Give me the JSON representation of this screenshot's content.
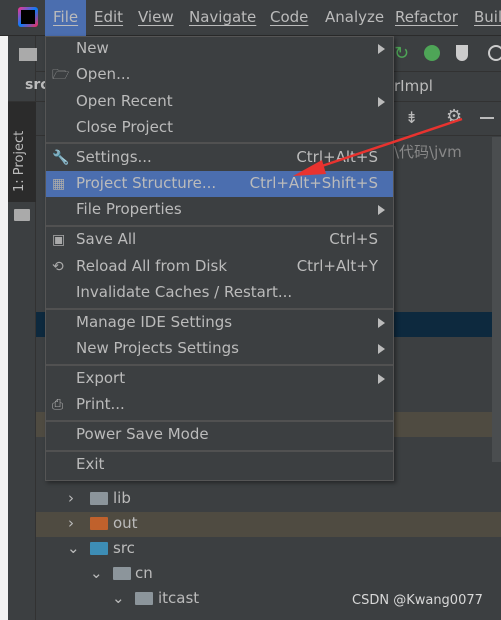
{
  "menubar": {
    "items": [
      "File",
      "Edit",
      "View",
      "Navigate",
      "Code",
      "Analyze",
      "Refactor",
      "Buil"
    ]
  },
  "sidebar": {
    "project_tab": "1: Project"
  },
  "tabs": {
    "left": "src",
    "right": "rImpl"
  },
  "path_text": "\\代码\\jvm",
  "tree": [
    {
      "label": "lib",
      "color": "#8c959b"
    },
    {
      "label": "out",
      "color": "#c0612c"
    },
    {
      "label": "src",
      "color": "#3d8db5"
    },
    {
      "label": "cn",
      "color": "#8c959b"
    },
    {
      "label": "itcast",
      "color": "#8c959b"
    }
  ],
  "file_menu": {
    "items": [
      {
        "label": "New",
        "submenu": true
      },
      {
        "label": "Open...",
        "icon": "folder-open-icon"
      },
      {
        "label": "Open Recent",
        "submenu": true
      },
      {
        "label": "Close Project"
      },
      {
        "label": "Settings...",
        "shortcut": "Ctrl+Alt+S",
        "icon": "wrench-icon"
      },
      {
        "label": "Project Structure...",
        "shortcut": "Ctrl+Alt+Shift+S",
        "icon": "project-structure-icon",
        "selected": true
      },
      {
        "label": "File Properties",
        "submenu": true
      },
      {
        "label": "Save All",
        "shortcut": "Ctrl+S",
        "icon": "save-icon"
      },
      {
        "label": "Reload All from Disk",
        "shortcut": "Ctrl+Alt+Y",
        "icon": "reload-icon"
      },
      {
        "label": "Invalidate Caches / Restart..."
      },
      {
        "label": "Manage IDE Settings",
        "submenu": true
      },
      {
        "label": "New Projects Settings",
        "submenu": true
      },
      {
        "label": "Export",
        "submenu": true
      },
      {
        "label": "Print...",
        "icon": "print-icon"
      },
      {
        "label": "Power Save Mode"
      },
      {
        "label": "Exit"
      }
    ]
  },
  "watermark": "CSDN @Kwang0077",
  "colors": {
    "accent": "#4b6eaf",
    "arrow": "#e8332f"
  }
}
